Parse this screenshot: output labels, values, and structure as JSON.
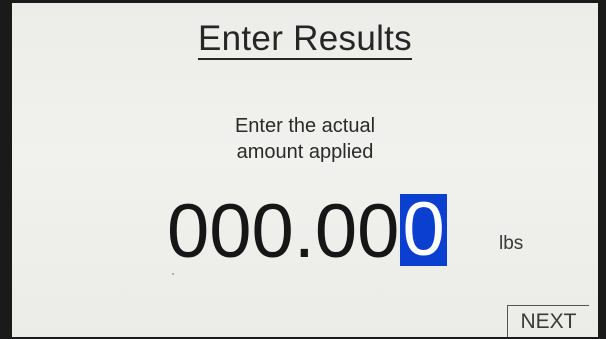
{
  "screen": {
    "title": "Enter Results",
    "instruction_line_1": "Enter the actual",
    "instruction_line_2": "amount applied"
  },
  "value_entry": {
    "entered_digits": "000.00",
    "cursor_digit": "0",
    "full_value": "000.000",
    "unit": "lbs"
  },
  "buttons": {
    "next_label": "NEXT"
  },
  "colors": {
    "screen_background": "#ecece9",
    "text": "#161616",
    "cursor_highlight": "#0a3fd0",
    "cursor_text": "#ffffff",
    "bezel": "#1a1a1a"
  }
}
